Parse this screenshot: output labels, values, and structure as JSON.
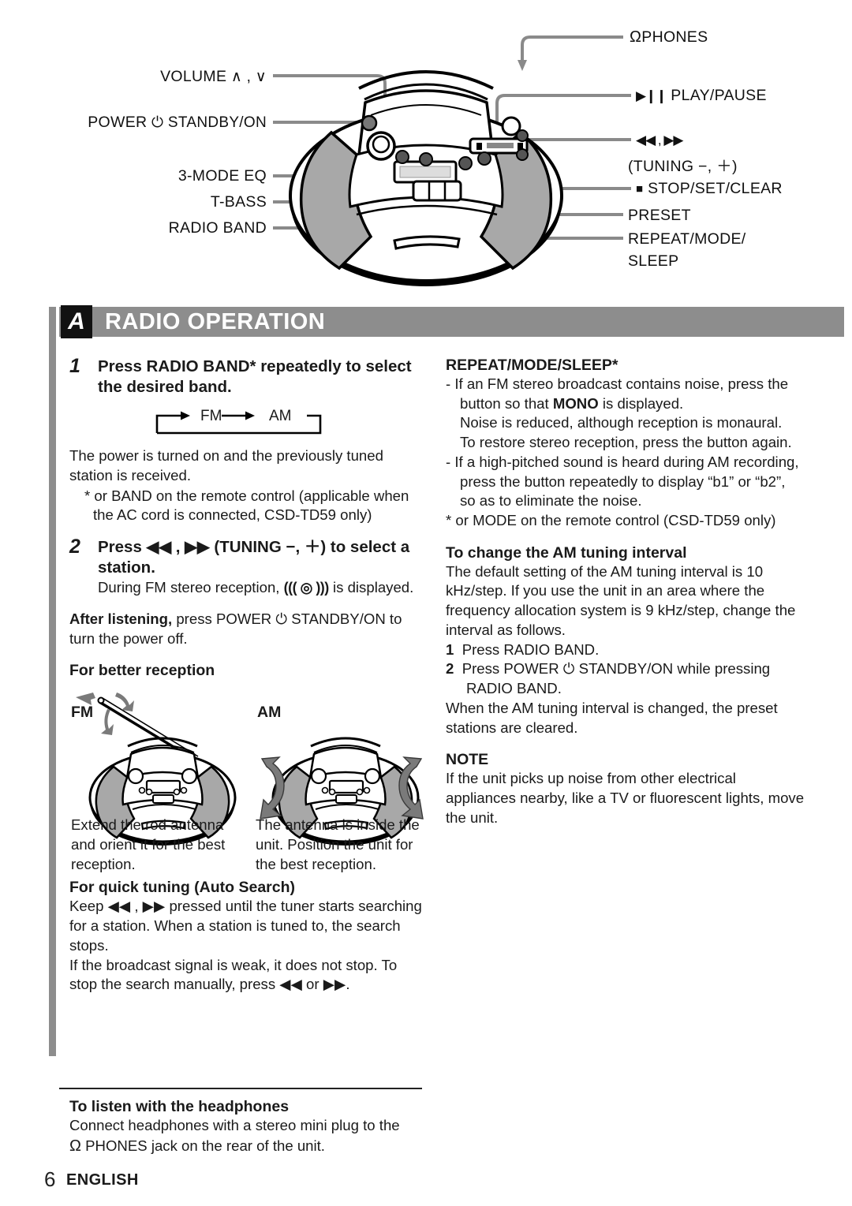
{
  "diagram": {
    "left_labels": [
      {
        "id": "volume",
        "text": "VOLUME",
        "suffix": " ∧ , ∨"
      },
      {
        "id": "power",
        "text": "POWER",
        "suffix": " ⏻ STANDBY/ON"
      },
      {
        "id": "eq",
        "text": "3-MODE EQ",
        "suffix": ""
      },
      {
        "id": "tbass",
        "text": "T-BASS",
        "suffix": ""
      },
      {
        "id": "band",
        "text": "RADIO BAND",
        "suffix": ""
      }
    ],
    "right_labels": [
      {
        "id": "phones",
        "icon": "Ω",
        "text": "PHONES"
      },
      {
        "id": "play",
        "icon": "▶❙❙",
        "text": "PLAY/PAUSE"
      },
      {
        "id": "ff",
        "icon": "◀◀ , ▶▶",
        "text": ""
      },
      {
        "id": "tuning",
        "icon": "",
        "text": "(TUNING −, ＋)"
      },
      {
        "id": "stop",
        "icon": "■",
        "text": "STOP/SET/CLEAR"
      },
      {
        "id": "preset",
        "icon": "",
        "text": "PRESET"
      },
      {
        "id": "repeat",
        "icon": "",
        "text": "REPEAT/MODE/"
      },
      {
        "id": "sleep",
        "icon": "",
        "text": "SLEEP"
      }
    ]
  },
  "section": {
    "badge": "A",
    "title": "RADIO OPERATION"
  },
  "left_column": {
    "step1": {
      "number": "1",
      "heading": "Press RADIO BAND* repeatedly to select the desired band.",
      "cycle": {
        "first": "FM",
        "second": "AM"
      },
      "body": "The power is turned on and the previously tuned station is received.",
      "footnote": "* or BAND on the remote control (applicable when the AC cord is connected, CSD-TD59 only)"
    },
    "step2": {
      "number": "2",
      "heading": "Press ◀◀ , ▶▶ (TUNING −, ＋) to select a station.",
      "body_pre": "During FM stereo reception,",
      "stereo_indicator": "((( ◎ )))",
      "body_post": "is displayed."
    },
    "after_listening": {
      "bold": "After listening,",
      "rest": " press POWER ⏻ STANDBY/ON to turn the power off."
    },
    "better_reception": {
      "heading": "For better reception",
      "fm_label": "FM",
      "am_label": "AM",
      "fm_caption": "Extend the rod antenna and orient it for the best reception.",
      "am_caption": "The antenna is inside the unit. Position the unit for the best reception."
    },
    "quick_tuning": {
      "heading": "For quick tuning (Auto Search)",
      "line1": "Keep ◀◀ , ▶▶ pressed until the tuner starts searching for a station. When a station is tuned to, the search stops.",
      "line2": "If the broadcast signal is weak, it does not stop. To stop the search manually, press ◀◀ or ▶▶."
    }
  },
  "right_column": {
    "repeat_mode_sleep": {
      "heading": "REPEAT/MODE/SLEEP*",
      "bullet1_a": "If an FM stereo broadcast contains noise, press the button so that",
      "bullet1_mono": "MONO",
      "bullet1_b": "is displayed.",
      "bullet1_c": "Noise is reduced, although reception is monaural.",
      "bullet1_d": "To restore stereo reception, press the button again.",
      "bullet2": "If a high-pitched sound is heard during AM recording, press the button repeatedly to display “b1” or “b2”, so as to eliminate the noise.",
      "footnote": "* or MODE on the remote control (CSD-TD59 only)"
    },
    "am_interval": {
      "heading": "To change the AM tuning interval",
      "intro": "The default setting of the AM tuning interval is 10 kHz/step. If you use the unit in an area where the frequency allocation system is 9 kHz/step, change the interval as follows.",
      "steps": [
        {
          "num": "1",
          "text": "Press RADIO BAND."
        },
        {
          "num": "2",
          "text": "Press POWER ⏻ STANDBY/ON while pressing RADIO BAND."
        }
      ],
      "outro": "When the AM tuning interval is changed, the preset stations are cleared."
    },
    "note": {
      "heading": "NOTE",
      "text": "If the unit picks up noise from other electrical appliances nearby, like a TV or fluorescent lights, move the unit."
    }
  },
  "footer": {
    "heading": "To listen with the headphones",
    "text_pre": "Connect headphones with a stereo mini plug to the",
    "icon": "Ω",
    "text_post": "PHONES jack on the rear of the unit.",
    "page_number": "6",
    "language": "ENGLISH"
  },
  "colors": {
    "header_bar": "#8d8d8d",
    "badge": "#111111",
    "leader_line": "#8a8a8a",
    "speaker_fill": "#a8a8a8",
    "text": "#1a1a1a"
  }
}
